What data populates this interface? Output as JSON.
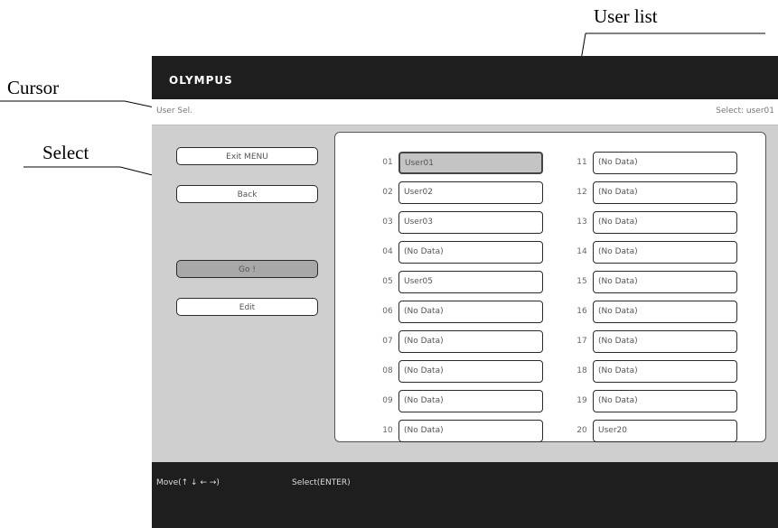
{
  "callouts": {
    "user_list": "User list",
    "cursor": "Cursor",
    "select": "Select"
  },
  "header": {
    "logo": "OLYMPUS",
    "title": "User Sel.",
    "status": "Select: user01"
  },
  "menu": {
    "exit": "Exit MENU",
    "back": "Back",
    "go": "Go !",
    "edit": "Edit"
  },
  "users": {
    "left": [
      {
        "num": "01",
        "label": "User01"
      },
      {
        "num": "02",
        "label": "User02"
      },
      {
        "num": "03",
        "label": "User03"
      },
      {
        "num": "04",
        "label": "(No Data)"
      },
      {
        "num": "05",
        "label": "User05"
      },
      {
        "num": "06",
        "label": "(No Data)"
      },
      {
        "num": "07",
        "label": "(No Data)"
      },
      {
        "num": "08",
        "label": "(No Data)"
      },
      {
        "num": "09",
        "label": "(No Data)"
      },
      {
        "num": "10",
        "label": "(No Data)"
      }
    ],
    "right": [
      {
        "num": "11",
        "label": "(No Data)"
      },
      {
        "num": "12",
        "label": "(No Data)"
      },
      {
        "num": "13",
        "label": "(No Data)"
      },
      {
        "num": "14",
        "label": "(No Data)"
      },
      {
        "num": "15",
        "label": "(No Data)"
      },
      {
        "num": "16",
        "label": "(No Data)"
      },
      {
        "num": "17",
        "label": "(No Data)"
      },
      {
        "num": "18",
        "label": "(No Data)"
      },
      {
        "num": "19",
        "label": "(No Data)"
      },
      {
        "num": "20",
        "label": "User20"
      }
    ]
  },
  "footer": {
    "move": "Move(↑ ↓ ← →)",
    "select": "Select(ENTER)"
  }
}
